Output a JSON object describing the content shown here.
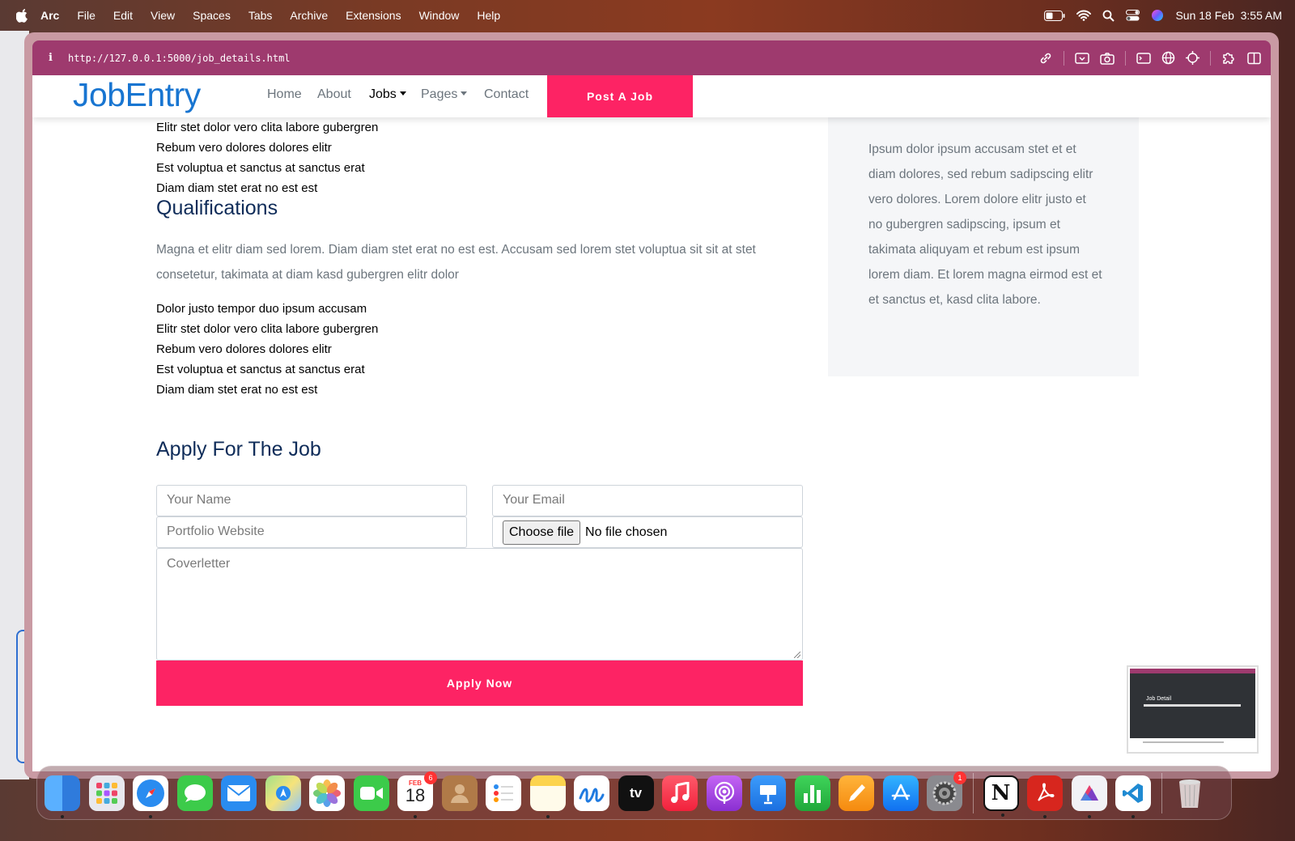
{
  "menubar": {
    "app": "Arc",
    "items": [
      "File",
      "Edit",
      "View",
      "Spaces",
      "Tabs",
      "Archive",
      "Extensions",
      "Window",
      "Help"
    ],
    "clock": "Sun 18 Feb  3:55 AM"
  },
  "browser": {
    "url": "http://127.0.0.1:5000/job_details.html",
    "info_icon": "i"
  },
  "navbar": {
    "brand": "JobEntry",
    "links": {
      "home": "Home",
      "about": "About",
      "jobs": "Jobs",
      "pages": "Pages",
      "contact": "Contact"
    },
    "post_job": "Post A Job"
  },
  "job": {
    "responsibility_items_partial": [
      "Elitr stet dolor vero clita labore gubergren",
      "Rebum vero dolores dolores elitr",
      "Est voluptua et sanctus at sanctus erat",
      "Diam diam stet erat no est est"
    ],
    "qualifications_title": "Qualifications",
    "qualifications_text": "Magna et elitr diam sed lorem. Diam diam stet erat no est est. Accusam sed lorem stet voluptua sit sit at stet consetetur, takimata at diam kasd gubergren elitr dolor",
    "qualification_items": [
      "Dolor justo tempor duo ipsum accusam",
      "Elitr stet dolor vero clita labore gubergren",
      "Rebum vero dolores dolores elitr",
      "Est voluptua et sanctus at sanctus erat",
      "Diam diam stet erat no est est"
    ]
  },
  "sidebar": {
    "text": "Ipsum dolor ipsum accusam stet et et diam dolores, sed rebum sadipscing elitr vero dolores. Lorem dolore elitr justo et no gubergren sadipscing, ipsum et takimata aliquyam et rebum est ipsum lorem diam. Et lorem magna eirmod est et et sanctus et, kasd clita labore."
  },
  "apply": {
    "title": "Apply For The Job",
    "name_placeholder": "Your Name",
    "email_placeholder": "Your Email",
    "portfolio_placeholder": "Portfolio Website",
    "file_button": "Choose file",
    "file_status": "No file chosen",
    "cover_placeholder": "Coverletter",
    "submit": "Apply Now"
  },
  "thumbnail": {
    "title": "Job Detail"
  },
  "dock": {
    "calendar_month": "FEB",
    "calendar_day": "18",
    "calendar_badge": "6",
    "settings_badge": "1",
    "appletv": "tv",
    "notion": "N",
    "apps": [
      "finder",
      "launchpad",
      "safari",
      "messages",
      "mail",
      "maps",
      "photos",
      "facetime",
      "calendar",
      "contacts",
      "reminders",
      "notes",
      "freeform",
      "tv",
      "music",
      "podcasts",
      "keynote",
      "numbers",
      "pages",
      "app-store",
      "system-settings",
      "notion",
      "acrobat",
      "affinity",
      "vscode",
      "trash"
    ]
  },
  "colors": {
    "accent": "#fd2364",
    "brand": "#1875d1",
    "heading": "#0f2c59",
    "toolbar": "#9e3a6e"
  }
}
